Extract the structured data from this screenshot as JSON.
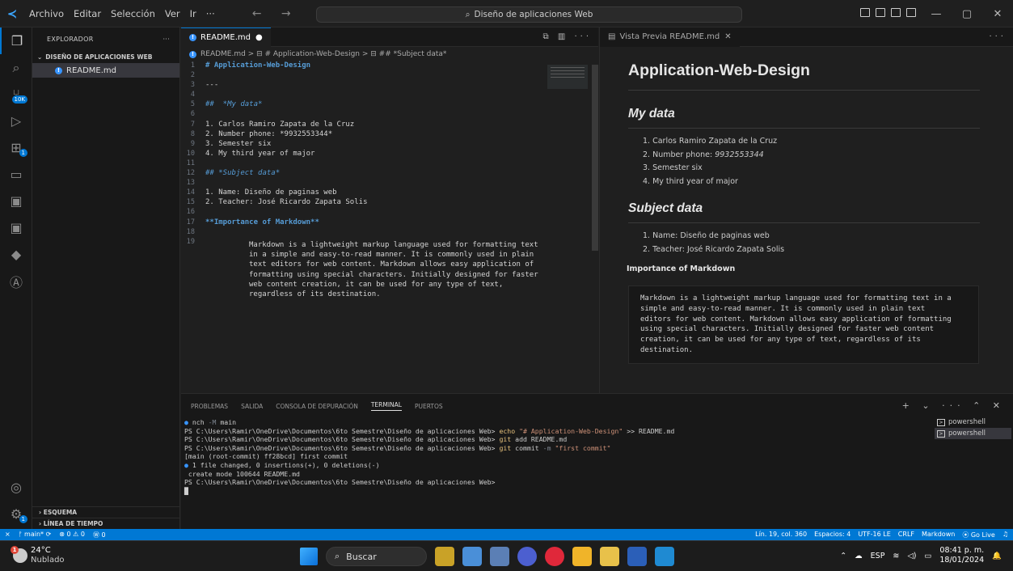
{
  "titlebar": {
    "menu": [
      "Archivo",
      "Editar",
      "Selección",
      "Ver",
      "Ir",
      "···"
    ],
    "nav": "← →",
    "command_center": "Diseño de aplicaciones Web",
    "window_buttons": [
      "—",
      "▢",
      "✕"
    ]
  },
  "activity": {
    "badge_scm": "10K",
    "badge_ext": "1",
    "badge_acct": "1"
  },
  "sidebar": {
    "header": "EXPLORADOR",
    "more": "···",
    "folder": "DISEÑO DE APLICACIONES WEB",
    "file": "README.md",
    "outline": "ESQUEMA",
    "timeline": "LÍNEA DE TIEMPO"
  },
  "editor": {
    "tab": "README.md",
    "tab_dirty": "●",
    "tab_actions": "⧉ ▥ ···",
    "breadcrumb": "README.md > ⊟ # Application-Web-Design > ⊟ ## *Subject data*",
    "lines": [
      {
        "n": "1",
        "t": "# Application-Web-Design"
      },
      {
        "n": "2",
        "t": ""
      },
      {
        "n": "3",
        "t": "---"
      },
      {
        "n": "4",
        "t": ""
      },
      {
        "n": "5",
        "t": "##  *My data*"
      },
      {
        "n": "6",
        "t": ""
      },
      {
        "n": "7",
        "t": "1. Carlos Ramiro Zapata de la Cruz"
      },
      {
        "n": "8",
        "t": "2. Number phone: *9932553344*"
      },
      {
        "n": "9",
        "t": "3. Semester six"
      },
      {
        "n": "10",
        "t": "4. My third year of major"
      },
      {
        "n": "11",
        "t": ""
      },
      {
        "n": "12",
        "t": "## *Subject data*"
      },
      {
        "n": "13",
        "t": ""
      },
      {
        "n": "14",
        "t": "1. Name: Diseño de paginas web"
      },
      {
        "n": "15",
        "t": "2. Teacher: José Ricardo Zapata Solis"
      },
      {
        "n": "16",
        "t": ""
      },
      {
        "n": "17",
        "t": "**Importance of Markdown**"
      },
      {
        "n": "18",
        "t": ""
      },
      {
        "n": "19",
        "t": ""
      }
    ],
    "block": [
      "Markdown is a lightweight markup language used for formatting text",
      "in a simple and easy-to-read manner. It is commonly used in plain",
      "text editors for web content. Markdown allows easy application of",
      "formatting using special characters. Initially designed for faster",
      "web content creation, it can be used for any type of text,",
      "regardless of its destination."
    ]
  },
  "preview": {
    "tab": "Vista Previa README.md",
    "tab_close": "✕",
    "more": "···",
    "h1": "Application-Web-Design",
    "h2_my": "My data",
    "my_items": [
      "1. Carlos Ramiro Zapata de la Cruz",
      "2. Number phone: 9932553344",
      "3. Semester six",
      "4. My third year of major"
    ],
    "h2_subject": "Subject data",
    "subject_items": [
      "1. Name: Diseño de paginas web",
      "2. Teacher: José Ricardo Zapata Solis"
    ],
    "strong": "Importance of Markdown",
    "pre": "Markdown is a lightweight markup language used for formatting text in a\nsimple and easy-to-read manner. It is commonly used in plain text\neditors for web content. Markdown allows easy application of formatting\nusing special characters. Initially designed for faster web content\ncreation, it can be used for any type of text, regardless of its\ndestination."
  },
  "panel": {
    "tabs": [
      "PROBLEMAS",
      "SALIDA",
      "CONSOLA DE DEPURACIÓN",
      "TERMINAL",
      "PUERTOS"
    ],
    "actions": "+ ⌄ ··· ⌃ ✕",
    "shells": [
      "powershell",
      "powershell"
    ],
    "prompt": "PS C:\\Users\\Ramir\\OneDrive\\Documentos\\6to Semestre\\Diseño de aplicaciones Web>",
    "t0a": "nch ",
    "t0b": "-M",
    "t0c": " main",
    "echo": "echo",
    "echo_str": "\"# Application-Web-Design\"",
    "echo_rest": " >> README.md",
    "git": "git",
    "add_rest": " add README.md",
    "commit_rest": " commit ",
    "commit_flag": "-m",
    "commit_str": "\"first commit\"",
    "out1": "[main (root-commit) ff28bcd] first commit",
    "out2": "1 file changed, 0 insertions(+), 0 deletions(-)",
    "out3": " create mode 100644 README.md"
  },
  "statusbar": {
    "branch": "ᚠ main* ⟳",
    "problems": "⊗ 0 ⚠ 0",
    "ports": "Ⓦ 0",
    "position": "Lín. 19, col. 360",
    "spaces": "Espacios: 4",
    "encoding": "UTF-16 LE",
    "eol": "CRLF",
    "language": "Markdown",
    "golive": "⦿ Go Live",
    "bell": "🔔"
  },
  "taskbar": {
    "temp": "24°C",
    "weather": "Nublado",
    "weather_badge": "1",
    "search": "Buscar",
    "lang": "ESP",
    "time": "08:41 p. m.",
    "date": "18/01/2024"
  }
}
